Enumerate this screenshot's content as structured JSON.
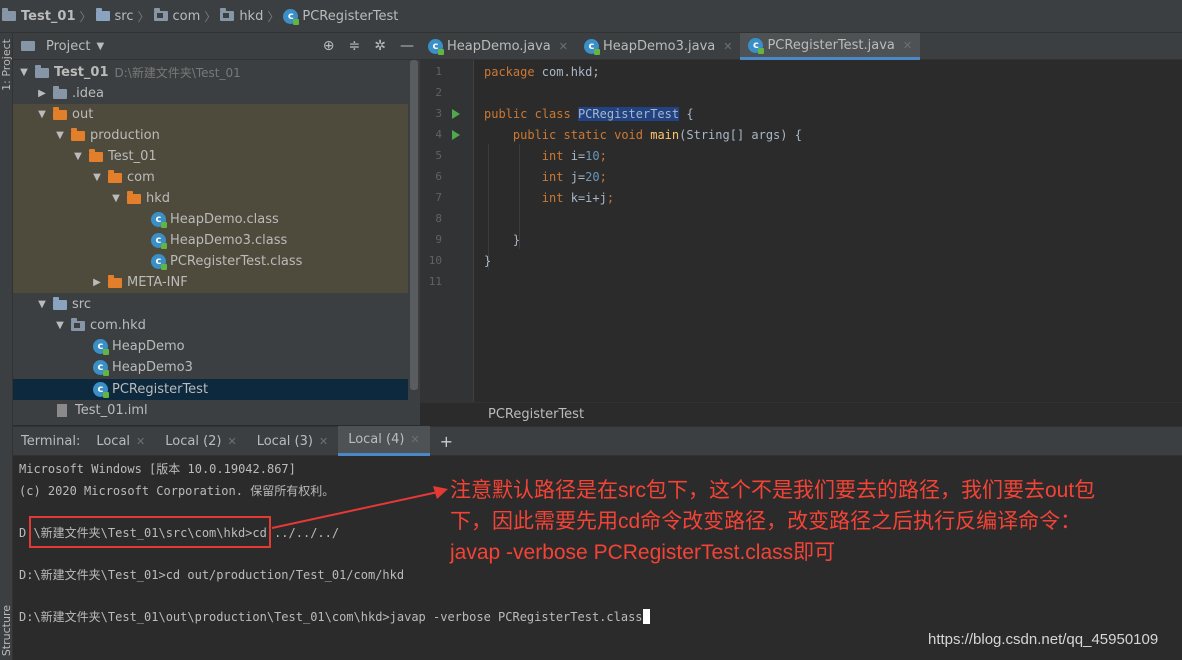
{
  "breadcrumbs": [
    "Test_01",
    "src",
    "com",
    "hkd",
    "PCRegisterTest"
  ],
  "left_stripe": {
    "project": "1: Project",
    "structure": "Structure"
  },
  "project_panel": {
    "title": "Project"
  },
  "tree": [
    {
      "label": "Test_01",
      "path": "D:\\新建文件夹\\Test_01"
    },
    {
      "label": ".idea"
    },
    {
      "label": "out"
    },
    {
      "label": "production"
    },
    {
      "label": "Test_01"
    },
    {
      "label": "com"
    },
    {
      "label": "hkd"
    },
    {
      "label": "HeapDemo.class"
    },
    {
      "label": "HeapDemo3.class"
    },
    {
      "label": "PCRegisterTest.class"
    },
    {
      "label": "META-INF"
    },
    {
      "label": "src"
    },
    {
      "label": "com.hkd"
    },
    {
      "label": "HeapDemo"
    },
    {
      "label": "HeapDemo3"
    },
    {
      "label": "PCRegisterTest"
    },
    {
      "label": "Test_01.iml"
    }
  ],
  "editor_tabs": [
    "HeapDemo.java",
    "HeapDemo3.java",
    "PCRegisterTest.java"
  ],
  "line_numbers": [
    "1",
    "2",
    "3",
    "4",
    "5",
    "6",
    "7",
    "8",
    "9",
    "10",
    "11"
  ],
  "code": {
    "package_kw": "package",
    "package_name": " com.hkd;",
    "public_kw": "public",
    "class_kw": "class",
    "class_name": "PCRegisterTest",
    "brace_open": " {",
    "main_public": "public",
    "main_static": "static",
    "main_void": "void",
    "main_name": "main",
    "main_params": "(String[] args) {",
    "int_kw": "int",
    "i_decl": " i=",
    "i_val": "10",
    "j_decl": " j=",
    "j_val": "20",
    "k_decl": " k=i+j",
    "semicolon": ";",
    "brace_close": "}"
  },
  "editor_breadcrumb": "PCRegisterTest",
  "terminal": {
    "label": "Terminal:",
    "tabs": [
      "Local",
      "Local (2)",
      "Local (3)",
      "Local (4)"
    ],
    "plus": "+",
    "lines": [
      "Microsoft Windows [版本 10.0.19042.867]",
      "(c) 2020 Microsoft Corporation. 保留所有权利。",
      "D:\\新建文件夹\\Test_01\\src\\com\\hkd>cd ../../../",
      "D:\\新建文件夹\\Test_01>cd out/production/Test_01/com/hkd",
      "D:\\新建文件夹\\Test_01\\out\\production\\Test_01\\com\\hkd>javap -verbose PCRegisterTest.class"
    ]
  },
  "annotation": {
    "line1": "注意默认路径是在src包下，这个不是我们要去的路径，我们要去out包",
    "line2": "下，因此需要先用cd命令改变路径，改变路径之后执行反编译命令：",
    "line3": "javap -verbose PCRegisterTest.class即可"
  },
  "watermark": "https://blog.csdn.net/qq_45950109",
  "colors": {
    "annotation": "#f44336",
    "selection": "#0d293e",
    "accent": "#4a88c7"
  }
}
